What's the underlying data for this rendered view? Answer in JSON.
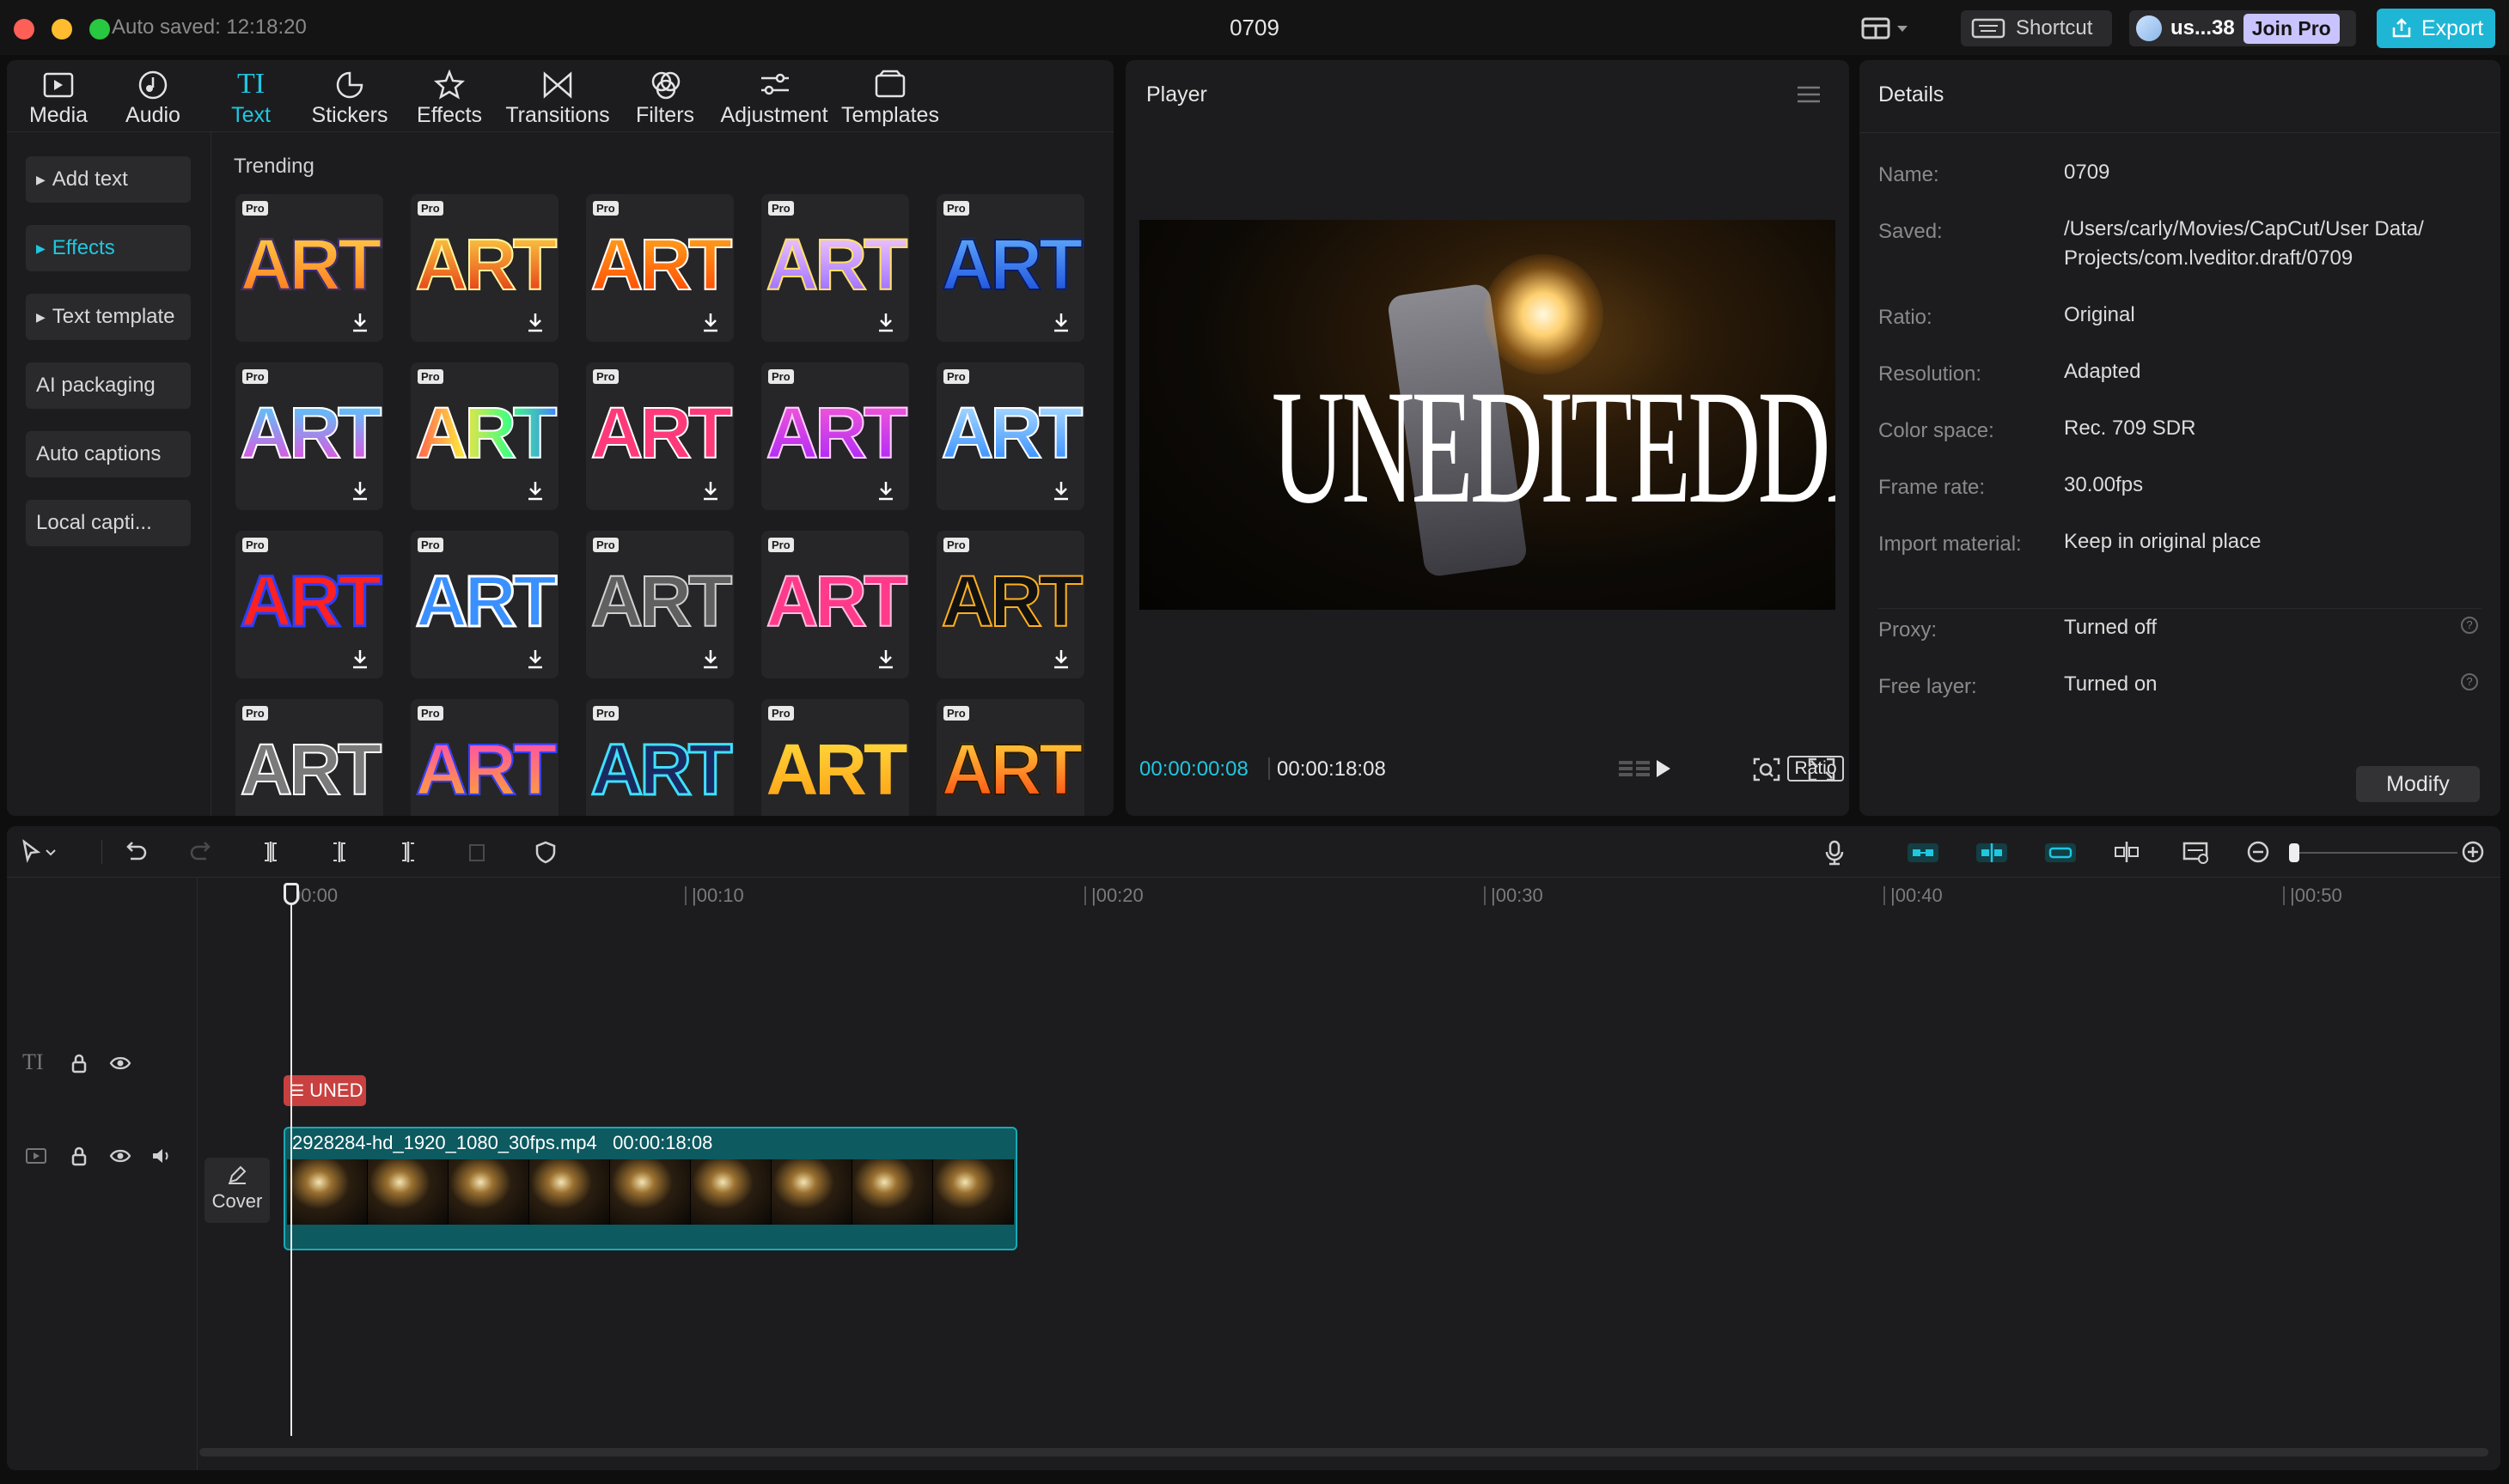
{
  "titlebar": {
    "autosave": "Auto saved: 12:18:20",
    "title": "0709",
    "shortcut_label": "Shortcut",
    "user_name": "us...38",
    "join_pro": "Join Pro",
    "export_label": "Export",
    "colors": {
      "close": "#fe5f57",
      "minimize": "#febc2e",
      "zoom": "#28c840",
      "accent": "#1fb6d5"
    }
  },
  "tool_tabs": [
    {
      "label": "Media",
      "icon": "media-icon"
    },
    {
      "label": "Audio",
      "icon": "audio-icon"
    },
    {
      "label": "Text",
      "icon": "text-icon",
      "active": true
    },
    {
      "label": "Stickers",
      "icon": "stickers-icon"
    },
    {
      "label": "Effects",
      "icon": "effects-icon"
    },
    {
      "label": "Transitions",
      "icon": "transitions-icon"
    },
    {
      "label": "Filters",
      "icon": "filters-icon"
    },
    {
      "label": "Adjustment",
      "icon": "adjustment-icon"
    },
    {
      "label": "Templates",
      "icon": "templates-icon"
    }
  ],
  "text_icon_glyph": "TI",
  "side_menu": [
    {
      "label": "Add text",
      "has_arrow": true
    },
    {
      "label": "Effects",
      "has_arrow": true,
      "active": true
    },
    {
      "label": "Text template",
      "has_arrow": true
    },
    {
      "label": "AI packaging"
    },
    {
      "label": "Auto captions"
    },
    {
      "label": "Local capti..."
    }
  ],
  "trending": {
    "label": "Trending",
    "badge": "Pro",
    "card_text": "ART"
  },
  "player": {
    "title": "Player",
    "overlay_text": "UNEDITEDDAY",
    "time_current": "00:00:00:08",
    "time_total": "00:00:18:08",
    "ratio_label": "Ratio"
  },
  "details": {
    "title": "Details",
    "rows": [
      {
        "label": "Name:",
        "value": "0709"
      },
      {
        "label": "Saved:",
        "value": "/Users/carly/Movies/CapCut/User Data/ Projects/com.lveditor.draft/0709"
      },
      {
        "label": "Ratio:",
        "value": "Original"
      },
      {
        "label": "Resolution:",
        "value": "Adapted"
      },
      {
        "label": "Color space:",
        "value": "Rec. 709 SDR"
      },
      {
        "label": "Frame rate:",
        "value": "30.00fps"
      },
      {
        "label": "Import material:",
        "value": "Keep in original place"
      },
      {
        "label": "Proxy:",
        "value": "Turned off"
      },
      {
        "label": "Free layer:",
        "value": "Turned on"
      }
    ],
    "modify_label": "Modify"
  },
  "timeline": {
    "ruler": [
      "00:00",
      "|00:10",
      "|00:20",
      "|00:30",
      "|00:40",
      "|00:50"
    ],
    "text_clip_label": "UNED",
    "video_clip_name": "2928284-hd_1920_1080_30fps.mp4",
    "video_clip_duration": "00:00:18:08",
    "cover_label": "Cover"
  }
}
